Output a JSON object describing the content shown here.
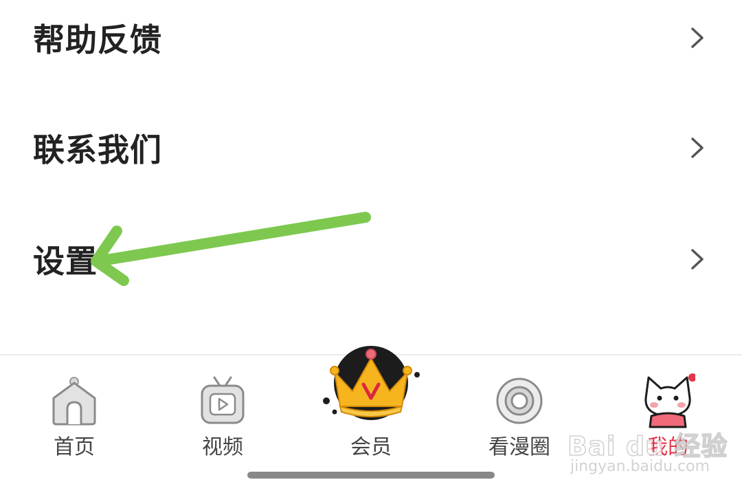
{
  "menu": {
    "items": [
      {
        "label": "帮助反馈"
      },
      {
        "label": "联系我们"
      },
      {
        "label": "设置"
      }
    ]
  },
  "annotation": {
    "color": "#7ec850"
  },
  "tabbar": {
    "active_color": "#e5334a",
    "tabs": [
      {
        "label": "首页",
        "icon": "home-icon"
      },
      {
        "label": "视频",
        "icon": "tv-play-icon"
      },
      {
        "label": "会员",
        "icon": "crown-icon"
      },
      {
        "label": "看漫圈",
        "icon": "circle-ring-icon"
      },
      {
        "label": "我的",
        "icon": "cat-avatar-icon",
        "active": true,
        "has_badge": true
      }
    ]
  },
  "watermark": {
    "brand": "Bai du 经验",
    "sub": "jingyan.baidu.com"
  }
}
